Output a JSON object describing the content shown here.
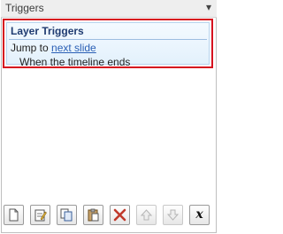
{
  "panel": {
    "title": "Triggers",
    "collapse_icon": "caret-down-icon"
  },
  "triggers": {
    "section_header": "Layer Triggers",
    "action_prefix": "Jump to",
    "action_link": "next slide",
    "condition": "When the timeline ends"
  },
  "toolbar": {
    "buttons": [
      {
        "icon": "new-trigger-icon"
      },
      {
        "icon": "edit-trigger-icon"
      },
      {
        "icon": "copy-icon"
      },
      {
        "icon": "paste-icon"
      },
      {
        "icon": "delete-icon"
      },
      {
        "icon": "move-up-icon",
        "state": "disabled"
      },
      {
        "icon": "move-down-icon",
        "state": "disabled"
      },
      {
        "icon": "variables-icon"
      }
    ]
  },
  "colors": {
    "highlight_border": "#d6121f",
    "header_text": "#1f3b70",
    "link": "#2a5fb5"
  }
}
